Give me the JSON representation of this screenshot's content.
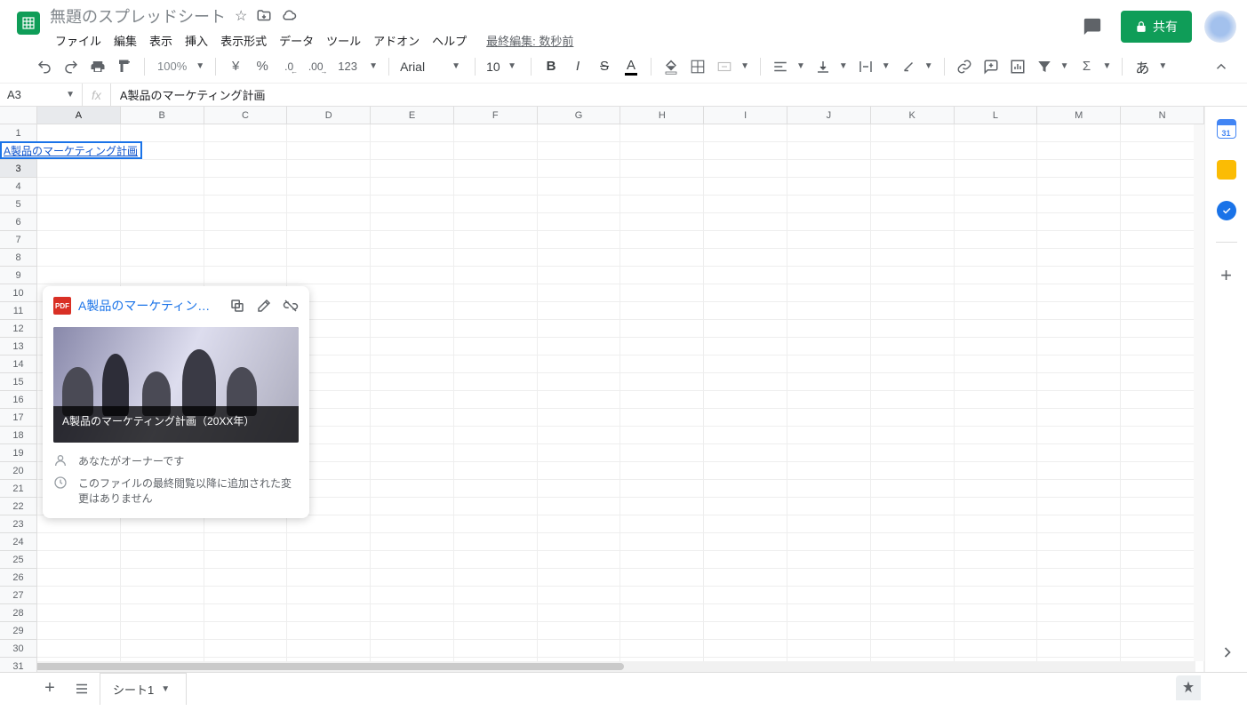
{
  "header": {
    "title": "無題のスプレッドシート",
    "menu": [
      "ファイル",
      "編集",
      "表示",
      "挿入",
      "表示形式",
      "データ",
      "ツール",
      "アドオン",
      "ヘルプ"
    ],
    "last_edit": "最終編集: 数秒前",
    "share_label": "共有"
  },
  "toolbar": {
    "zoom": "100%",
    "currency": "¥",
    "percent": "%",
    "dec_dec": ".0",
    "dec_inc": ".00",
    "num_fmt": "123",
    "font": "Arial",
    "size": "10",
    "input_mode": "あ"
  },
  "name_box": "A3",
  "formula": "A製品のマーケティング計画",
  "columns": [
    "A",
    "B",
    "C",
    "D",
    "E",
    "F",
    "G",
    "H",
    "I",
    "J",
    "K",
    "L",
    "M",
    "N"
  ],
  "rows": 31,
  "active_cell": {
    "col": 0,
    "row": 2
  },
  "cell_value": "A製品のマーケティング計画",
  "hover_card": {
    "badge": "PDF",
    "title": "A製品のマーケティング計…",
    "preview_caption": "A製品のマーケティング計画（20XX年）",
    "owner": "あなたがオーナーです",
    "changes": "このファイルの最終閲覧以降に追加された変更はありません"
  },
  "tab_bar": {
    "sheet_name": "シート1"
  },
  "side_panel": {
    "cal_day": "31"
  }
}
